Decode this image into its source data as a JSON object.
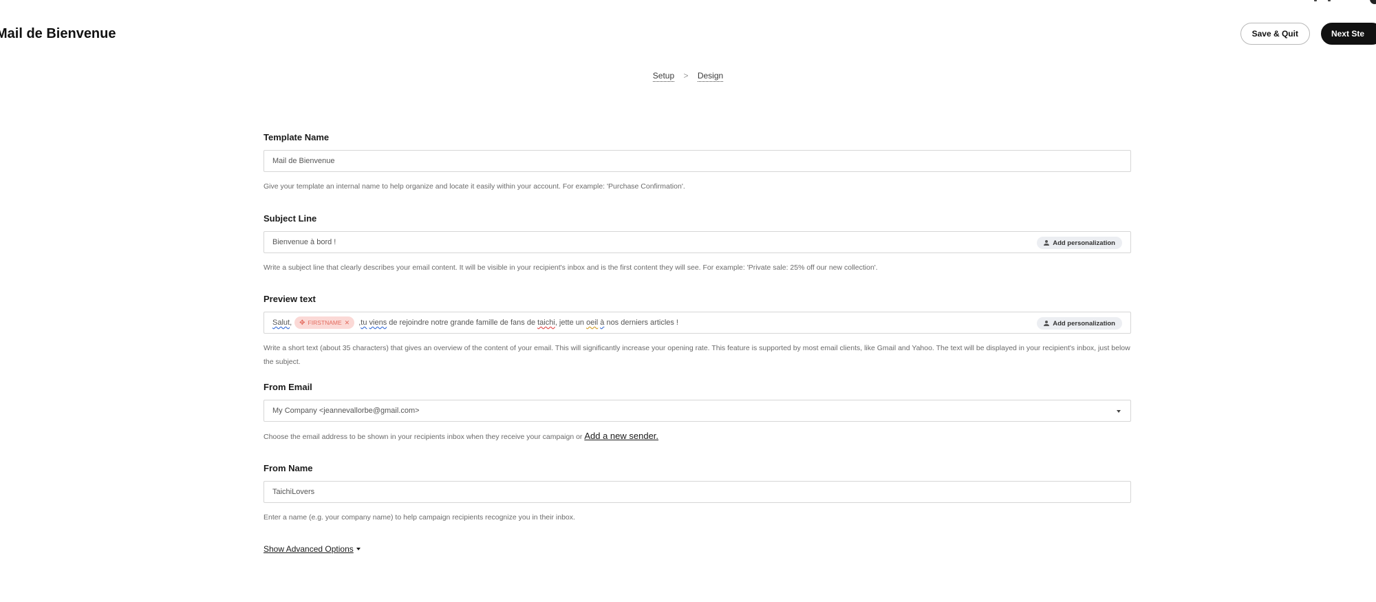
{
  "header": {
    "title": "Mail de Bienvenue",
    "save_quit_label": "Save & Quit",
    "next_step_label": "Next Ste"
  },
  "stepper": {
    "steps": [
      "Setup",
      "Design"
    ],
    "separator": ">"
  },
  "form": {
    "template_name": {
      "label": "Template Name",
      "value": "Mail de Bienvenue",
      "help": "Give your template an internal name to help organize and locate it easily within your account. For example: 'Purchase Confirmation'."
    },
    "subject_line": {
      "label": "Subject Line",
      "value": "Bienvenue à bord !",
      "personalization_label": "Add personalization",
      "help": "Write a subject line that clearly describes your email content. It will be visible in your recipient's inbox and is the first content they will see. For example: 'Private sale: 25% off our new collection'."
    },
    "preview_text": {
      "label": "Preview text",
      "segments": {
        "salut": "Salut",
        "comma1": ", ",
        "chip_label": "FIRSTNAME",
        "mid1": ", ",
        "tu": "tu",
        "space1": " ",
        "viens": "viens",
        "mid2": " de rejoindre notre grande famille de fans de ",
        "taichi": "taichi",
        "mid3": ", jette un ",
        "oeil": "oeil",
        "space2": " ",
        "a": "à",
        "end": " nos derniers articles !"
      },
      "personalization_label": "Add personalization",
      "help": "Write a short text (about 35 characters) that gives an overview of the content of your email. This will significantly increase your opening rate. This feature is supported by most email clients, like Gmail and Yahoo. The text will be displayed in your recipient's inbox, just below the subject."
    },
    "from_email": {
      "label": "From Email",
      "value": "My Company <jeannevallorbe@gmail.com>",
      "help": "Choose the email address to be shown in your recipients inbox when they receive your campaign or ",
      "link": "Add a new sender."
    },
    "from_name": {
      "label": "From Name",
      "value": "TaichiLovers",
      "help": "Enter a name (e.g. your company name) to help campaign recipients recognize you in their inbox."
    },
    "advanced_label": "Show Advanced Options"
  },
  "icons": {
    "personalization": "user-icon",
    "chip_move": "move-icon",
    "chip_remove": "close-icon",
    "dropdown": "chevron-down-icon"
  },
  "colors": {
    "primary_button": "#111111",
    "chip_bg": "#fbd9d6",
    "chip_text": "#e36b5e"
  }
}
